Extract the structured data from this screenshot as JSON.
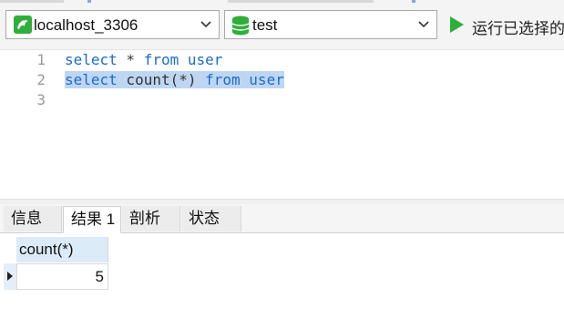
{
  "toolbar": {
    "connection": {
      "label": "localhost_3306",
      "icon": "mysql-connection-icon"
    },
    "database": {
      "label": "test",
      "icon": "database-icon"
    },
    "run_selected_label": "运行已选择的"
  },
  "editor": {
    "lines": [
      {
        "number": "1",
        "tokens": [
          [
            "kw",
            "select"
          ],
          [
            "pl",
            " * "
          ],
          [
            "kw",
            "from"
          ],
          [
            "pl",
            " "
          ],
          [
            "kw",
            "user"
          ]
        ],
        "selected": false
      },
      {
        "number": "2",
        "tokens": [
          [
            "kw",
            "select"
          ],
          [
            "pl",
            " count(*) "
          ],
          [
            "kw",
            "from"
          ],
          [
            "pl",
            " "
          ],
          [
            "kw",
            "user"
          ]
        ],
        "selected": true
      },
      {
        "number": "3",
        "tokens": [],
        "selected": false
      }
    ]
  },
  "tabs": [
    {
      "label": "信息",
      "active": false
    },
    {
      "label": "结果 1",
      "active": true
    },
    {
      "label": "剖析",
      "active": false
    },
    {
      "label": "状态",
      "active": false
    }
  ],
  "result": {
    "columns": [
      "count(*)"
    ],
    "rows": [
      [
        "5"
      ]
    ]
  },
  "colors": {
    "keyword": "#1b6bd1",
    "selection": "#bfd6f2",
    "run_green": "#2fae3c",
    "connection_green": "#2fae3c"
  }
}
